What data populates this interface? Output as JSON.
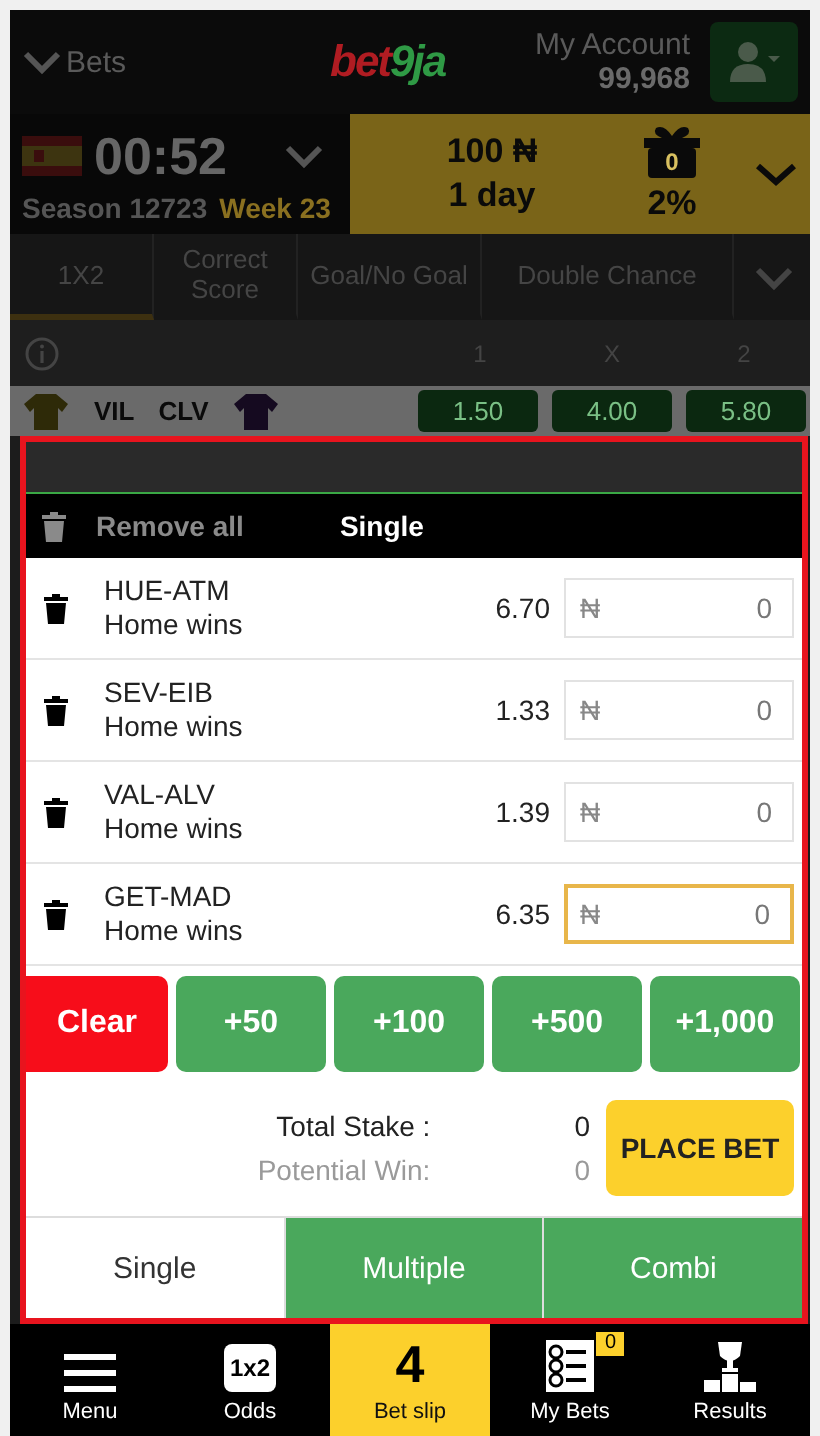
{
  "header": {
    "back_label": "Bets",
    "logo": {
      "left": "bet",
      "right": "9ja"
    },
    "account_label": "My Account",
    "balance": "99,968"
  },
  "timer": {
    "time": "00:52",
    "season": "Season 12723",
    "week": "Week 23"
  },
  "jackpot": {
    "amount": "100 ₦",
    "period": "1 day",
    "gift_count": "0",
    "percent": "2%"
  },
  "market_tabs": [
    {
      "label": "1X2",
      "selected": true
    },
    {
      "label": "Correct Score",
      "selected": false
    },
    {
      "label": "Goal/No Goal",
      "selected": false
    },
    {
      "label": "Double Chance",
      "selected": false
    }
  ],
  "odds_header": [
    "1",
    "X",
    "2"
  ],
  "match": {
    "home": "VIL",
    "away": "CLV",
    "odds": [
      "1.50",
      "4.00",
      "5.80"
    ]
  },
  "betslip": {
    "remove_all": "Remove all",
    "mode": "Single",
    "bets": [
      {
        "match": "HUE-ATM",
        "market": "Home wins",
        "odds": "6.70",
        "currency": "₦",
        "stake": "0",
        "focused": false
      },
      {
        "match": "SEV-EIB",
        "market": "Home wins",
        "odds": "1.33",
        "currency": "₦",
        "stake": "0",
        "focused": false
      },
      {
        "match": "VAL-ALV",
        "market": "Home wins",
        "odds": "1.39",
        "currency": "₦",
        "stake": "0",
        "focused": false
      },
      {
        "match": "GET-MAD",
        "market": "Home wins",
        "odds": "6.35",
        "currency": "₦",
        "stake": "0",
        "focused": true
      }
    ],
    "quick_stakes": [
      {
        "label": "Clear",
        "kind": "clear"
      },
      {
        "label": "+50",
        "kind": "add"
      },
      {
        "label": "+100",
        "kind": "add"
      },
      {
        "label": "+500",
        "kind": "add"
      },
      {
        "label": "+1,000",
        "kind": "add"
      }
    ],
    "total_stake_label": "Total Stake :",
    "total_stake": "0",
    "potential_win_label": "Potential Win:",
    "potential_win": "0",
    "place_bet": "PLACE BET",
    "type_tabs": [
      {
        "label": "Single",
        "selected": true
      },
      {
        "label": "Multiple",
        "selected": false
      },
      {
        "label": "Combi",
        "selected": false
      }
    ]
  },
  "bottom_nav": [
    {
      "label": "Menu",
      "kind": "menu",
      "selected": false
    },
    {
      "label": "Odds",
      "kind": "odds",
      "icon_text": "1x2",
      "selected": false
    },
    {
      "label": "Bet slip",
      "kind": "count",
      "icon_text": "4",
      "selected": true
    },
    {
      "label": "My Bets",
      "kind": "bets",
      "badge": "0",
      "selected": false
    },
    {
      "label": "Results",
      "kind": "trophy",
      "selected": false
    }
  ]
}
